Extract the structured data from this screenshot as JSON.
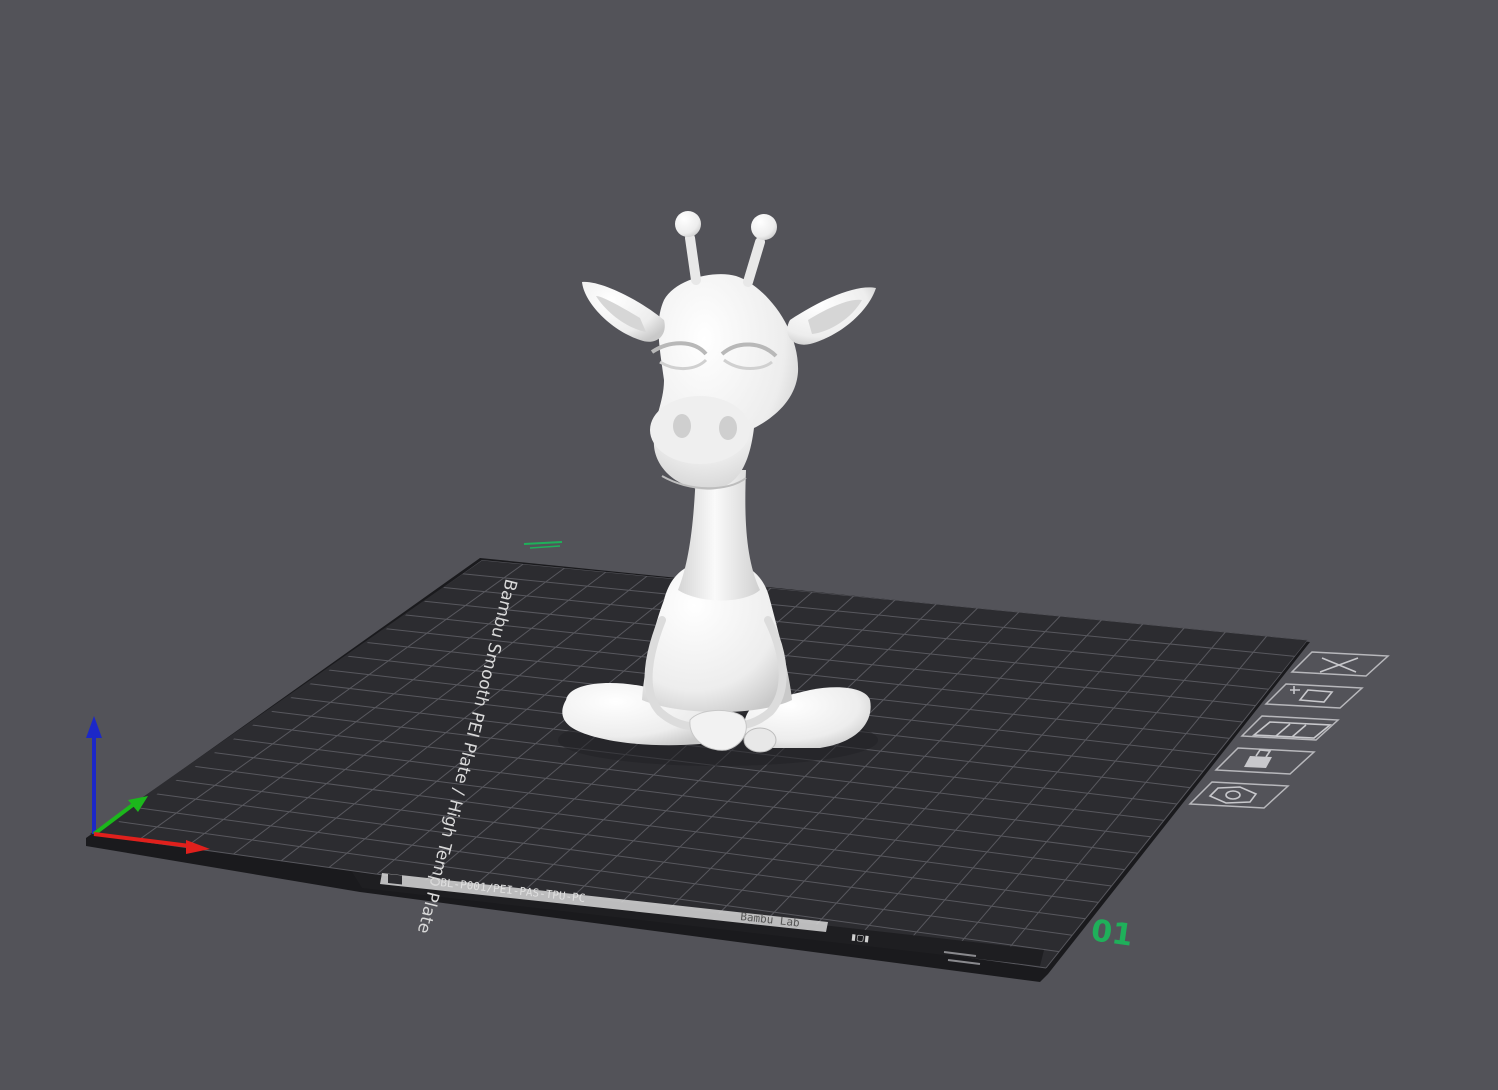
{
  "plate": {
    "label": "Bambu Smooth PEI Plate / High Temp Plate",
    "number": "01",
    "strip_code": "BL-P001/PEI-PAS-TPU-PC",
    "strip_brand": "Bambu Lab"
  },
  "model": {
    "name": "giraffe-figure",
    "color": "#f2f2f2"
  },
  "colors": {
    "background": "#535359",
    "plate": "#2c2c30",
    "grid": "#58585e",
    "axis_x": "#e0201c",
    "axis_y": "#1cb71c",
    "axis_z": "#1c28c8",
    "plate_number": "#1fb05a"
  },
  "plate_tools": [
    {
      "name": "close",
      "icon": "close-icon"
    },
    {
      "name": "auto-orient",
      "icon": "auto-orient-icon"
    },
    {
      "name": "arrange",
      "icon": "arrange-icon"
    },
    {
      "name": "lock",
      "icon": "lock-icon"
    },
    {
      "name": "settings",
      "icon": "settings-icon"
    }
  ]
}
